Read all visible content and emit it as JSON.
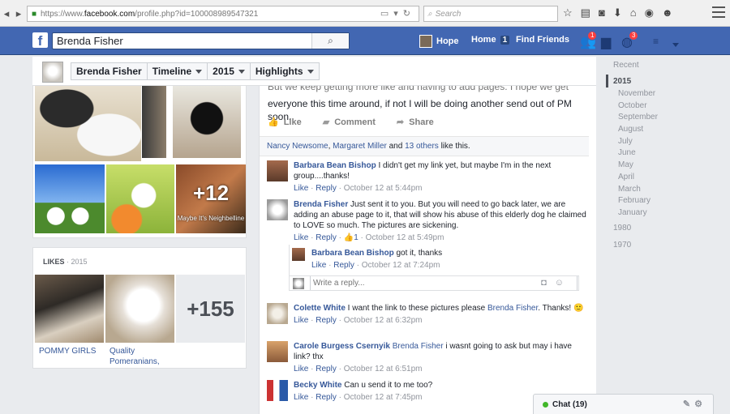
{
  "browser": {
    "url_prefix": "https://www.",
    "url_domain": "facebook.com",
    "url_path": "/profile.php?id=100008989547321",
    "search_placeholder": "Search"
  },
  "fb": {
    "search_value": "Brenda Fisher",
    "nav_user": "Hope",
    "nav_home": "Home",
    "nav_home_count": "1",
    "nav_find_friends": "Find Friends",
    "friend_requests_count": "1",
    "notifications_count": "3"
  },
  "timeline": {
    "crumbs": [
      "Brenda Fisher",
      "Timeline",
      "2015",
      "Highlights"
    ]
  },
  "photos": {
    "more_count": "+12",
    "caption": "Maybe It's Neighbelline"
  },
  "likes": {
    "heading": "LIKES",
    "year": "2015",
    "tiles": [
      {
        "label": "POMMY GIRLS"
      },
      {
        "label": "Quality Pomeranians,"
      },
      {
        "label": "+155"
      }
    ]
  },
  "post": {
    "text_clipped": "But we keep getting more like and having to add pages. I hope we get",
    "text_visible": "everyone this time around, if not I will be doing another send out of PM soon.",
    "actions": [
      "Like",
      "Comment",
      "Share"
    ],
    "likers": {
      "names": [
        "Nancy Newsome",
        "Margaret Miller"
      ],
      "and": "and",
      "others": "13 others",
      "suffix": "like this."
    }
  },
  "comments": [
    {
      "author": "Barbara Bean Bishop",
      "text": "I didn't get my link yet, but maybe I'm in the next group....thanks!",
      "time": "October 12 at 5:44pm"
    },
    {
      "author": "Brenda Fisher",
      "text": "Just sent it to you. But you will need to go back later, we are adding an abuse page to it, that will show his abuse of this elderly dog he claimed to LOVE so much. The pictures are sickening.",
      "likes": "1",
      "time": "October 12 at 5:49pm"
    },
    {
      "author": "Barbara Bean Bishop",
      "text": "got it, thanks",
      "time": "October 12 at 7:24pm"
    },
    {
      "author": "Colette White",
      "text": "I want the link to these pictures please",
      "mention": "Brenda Fisher",
      "text2": ". Thanks! 🙂",
      "time": "October 12 at 6:32pm"
    },
    {
      "author": "Carole Burgess Csernyik",
      "mention": "Brenda Fisher",
      "text": "i wasnt going to ask but may i have link? thx",
      "time": "October 12 at 6:51pm"
    },
    {
      "author": "Becky White",
      "text": "Can u send it to me too?",
      "time": "October 12 at 7:45pm"
    }
  ],
  "comment_actions": {
    "like": "Like",
    "reply": "Reply",
    "sep": "·"
  },
  "reply_placeholder": "Write a reply...",
  "years": {
    "recent": "Recent",
    "active": "2015",
    "months": [
      "November",
      "October",
      "September",
      "August",
      "July",
      "June",
      "May",
      "April",
      "March",
      "February",
      "January"
    ],
    "others": [
      "1980",
      "1970"
    ]
  },
  "chat": {
    "label": "Chat (19)"
  },
  "colors": {
    "fb_blue": "#4267b2",
    "link": "#365899",
    "online": "#42b72a",
    "badge_red": "#fa3e3e"
  }
}
